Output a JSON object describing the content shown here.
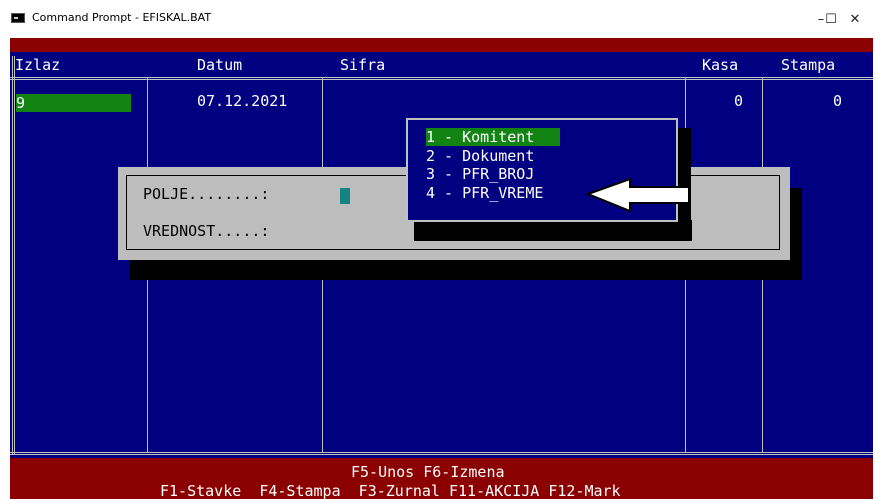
{
  "window": {
    "title": "Command Prompt - EFISKAL.BAT",
    "minimize": "–",
    "maximize": "☐",
    "close": "✕"
  },
  "table": {
    "headers": [
      "Izlaz",
      "Datum",
      "Sifra",
      "Kasa",
      "Stampa"
    ],
    "row": {
      "izlaz": "9",
      "datum": "07.12.2021",
      "kasa": "0",
      "stampa": "0"
    }
  },
  "dialog": {
    "field1_label": "POLJE........:",
    "field2_label": "VREDNOST.....:"
  },
  "menu": {
    "items": [
      "1 - Komitent",
      "2 - Dokument",
      "3 - PFR_BROJ",
      "4 - PFR_VREME"
    ],
    "selected_index": 0
  },
  "footer": {
    "line1": "F5-Unos F6-Izmena",
    "line2": "F1-Stavke  F4-Stampa  F3-Zurnal F11-AKCIJA F12-Mark"
  },
  "colors": {
    "console_bg": "#000080",
    "header_bar": "#8b0000",
    "highlight": "#138313",
    "dialog_bg": "#bdbdbd"
  },
  "icons": {
    "app": "console-icon",
    "arrow": "left-arrow-icon"
  }
}
